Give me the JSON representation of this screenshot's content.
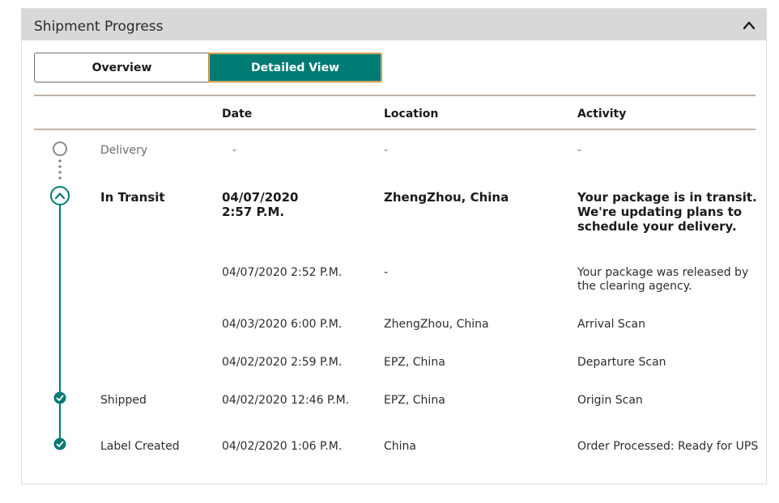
{
  "panel": {
    "title": "Shipment Progress"
  },
  "view_toggle": {
    "overview_label": "Overview",
    "detailed_label": "Detailed View",
    "selected": "Detailed View"
  },
  "table": {
    "headers": {
      "date": "Date",
      "location": "Location",
      "activity": "Activity"
    },
    "rows": [
      {
        "status": "Delivery",
        "date": "-",
        "location": "-",
        "activity": "-"
      },
      {
        "status": "In Transit",
        "date": "04/07/2020\n2:57 P.M.",
        "location": "ZhengZhou, China",
        "activity": "Your package is in transit.\nWe're updating plans to\nschedule your delivery."
      },
      {
        "status": "",
        "date": "04/07/2020  2:52 P.M.",
        "location": "-",
        "activity": "Your package was released by\nthe clearing agency."
      },
      {
        "status": "",
        "date": "04/03/2020  6:00 P.M.",
        "location": "ZhengZhou, China",
        "activity": "Arrival Scan"
      },
      {
        "status": "",
        "date": "04/02/2020  2:59 P.M.",
        "location": "EPZ, China",
        "activity": "Departure Scan"
      },
      {
        "status": "Shipped",
        "date": "04/02/2020  12:46 P.M.",
        "location": "EPZ, China",
        "activity": "Origin Scan"
      },
      {
        "status": "Label Created",
        "date": "04/02/2020  1:06 P.M.",
        "location": "China",
        "activity": "Order Processed: Ready for UPS"
      }
    ]
  },
  "colors": {
    "accent": "#007b74",
    "header_bg": "#d8d8d8",
    "pending_circle": "#8a8a8a"
  },
  "icons": {
    "collapse": "chevron-up-icon",
    "pending": "empty-circle-icon",
    "current": "chevron-up-circle-icon",
    "complete": "check-circle-icon"
  }
}
